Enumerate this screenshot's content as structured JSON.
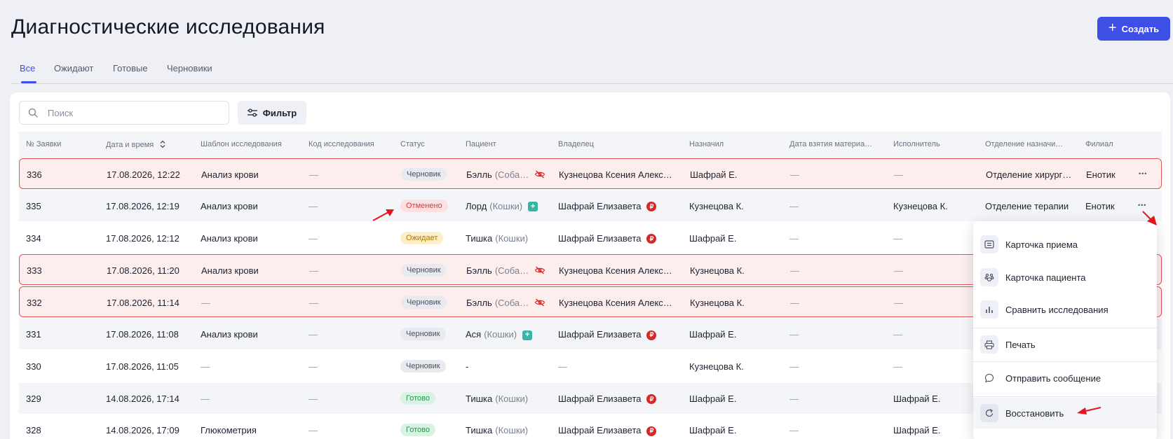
{
  "page": {
    "title": "Диагностические исследования",
    "create_label": "Создать"
  },
  "tabs": [
    {
      "label": "Все",
      "active": true
    },
    {
      "label": "Ожидают",
      "active": false
    },
    {
      "label": "Готовые",
      "active": false
    },
    {
      "label": "Черновики",
      "active": false
    }
  ],
  "toolbar": {
    "search_placeholder": "Поиск",
    "filter_label": "Фильтр"
  },
  "table": {
    "columns": [
      "№ Заявки",
      "Дата и время",
      "Шаблон исследования",
      "Код исследования",
      "Статус",
      "Пациент",
      "Владелец",
      "Назначил",
      "Дата взятия материа…",
      "Исполнитель",
      "Отделение назначи…",
      "Филиал"
    ],
    "rows": [
      {
        "id": "336",
        "datetime": "17.08.2026, 12:22",
        "template": "Анализ крови",
        "code": "—",
        "status": "Черновик",
        "status_kind": "draft",
        "patient": "Бэлль",
        "species": "(Соба…",
        "patient_icon": "eye-off-icon",
        "owner": "Кузнецова Ксения Алекс…",
        "owner_badge": "",
        "assigned": "Шафрай Е.",
        "sample_date": "—",
        "executor": "—",
        "department": "Отделение хирург…",
        "branch": "Енотик",
        "highlight": true
      },
      {
        "id": "335",
        "datetime": "17.08.2026, 12:19",
        "template": "Анализ крови",
        "code": "—",
        "status": "Отменено",
        "status_kind": "cancel",
        "patient": "Лорд",
        "species": "(Кошки)",
        "patient_icon": "medical-icon",
        "owner": "Шафрай Елизавета",
        "owner_badge": "₽",
        "assigned": "Кузнецова К.",
        "sample_date": "—",
        "executor": "Кузнецова К.",
        "department": "Отделение терапии",
        "branch": "Енотик",
        "highlight": false
      },
      {
        "id": "334",
        "datetime": "17.08.2026, 12:12",
        "template": "Анализ крови",
        "code": "—",
        "status": "Ожидает",
        "status_kind": "wait",
        "patient": "Тишка",
        "species": "(Кошки)",
        "patient_icon": "",
        "owner": "Шафрай Елизавета",
        "owner_badge": "₽",
        "assigned": "Шафрай Е.",
        "sample_date": "—",
        "executor": "—",
        "department": "",
        "branch": "",
        "highlight": false
      },
      {
        "id": "333",
        "datetime": "17.08.2026, 11:20",
        "template": "Анализ крови",
        "code": "—",
        "status": "Черновик",
        "status_kind": "draft",
        "patient": "Бэлль",
        "species": "(Соба…",
        "patient_icon": "eye-off-icon",
        "owner": "Кузнецова Ксения Алекс…",
        "owner_badge": "",
        "assigned": "Кузнецова К.",
        "sample_date": "—",
        "executor": "—",
        "department": "",
        "branch": "",
        "highlight": true
      },
      {
        "id": "332",
        "datetime": "17.08.2026, 11:14",
        "template": "—",
        "code": "—",
        "status": "Черновик",
        "status_kind": "draft",
        "patient": "Бэлль",
        "species": "(Соба…",
        "patient_icon": "eye-off-icon",
        "owner": "Кузнецова Ксения Алекс…",
        "owner_badge": "",
        "assigned": "Кузнецова К.",
        "sample_date": "—",
        "executor": "—",
        "department": "",
        "branch": "",
        "highlight": true
      },
      {
        "id": "331",
        "datetime": "17.08.2026, 11:08",
        "template": "Анализ крови",
        "code": "—",
        "status": "Черновик",
        "status_kind": "draft",
        "patient": "Ася",
        "species": "(Кошки)",
        "patient_icon": "medical-icon",
        "owner": "Шафрай Елизавета",
        "owner_badge": "₽",
        "assigned": "Шафрай Е.",
        "sample_date": "—",
        "executor": "—",
        "department": "",
        "branch": "",
        "highlight": false
      },
      {
        "id": "330",
        "datetime": "17.08.2026, 11:05",
        "template": "—",
        "code": "—",
        "status": "Черновик",
        "status_kind": "draft",
        "patient": "-",
        "species": "",
        "patient_icon": "",
        "owner": "—",
        "owner_badge": "",
        "assigned": "Кузнецова К.",
        "sample_date": "—",
        "executor": "—",
        "department": "",
        "branch": "",
        "highlight": false
      },
      {
        "id": "329",
        "datetime": "14.08.2026, 17:14",
        "template": "—",
        "code": "—",
        "status": "Готово",
        "status_kind": "ready",
        "patient": "Тишка",
        "species": "(Кошки)",
        "patient_icon": "",
        "owner": "Шафрай Елизавета",
        "owner_badge": "₽",
        "assigned": "Шафрай Е.",
        "sample_date": "—",
        "executor": "Шафрай Е.",
        "department": "",
        "branch": "",
        "highlight": false
      },
      {
        "id": "328",
        "datetime": "14.08.2026, 17:09",
        "template": "Глюкометрия",
        "code": "—",
        "status": "Готово",
        "status_kind": "ready",
        "patient": "Тишка",
        "species": "(Кошки)",
        "patient_icon": "",
        "owner": "Шафрай Елизавета",
        "owner_badge": "₽",
        "assigned": "Шафрай Е.",
        "sample_date": "—",
        "executor": "Шафрай Е.",
        "department": "",
        "branch": "",
        "highlight": false
      }
    ]
  },
  "menu": {
    "items": [
      {
        "label": "Карточка приема",
        "icon": "appointment-card-icon"
      },
      {
        "label": "Карточка пациента",
        "icon": "paw-icon"
      },
      {
        "label": "Сравнить исследования",
        "icon": "bar-chart-icon"
      },
      {
        "label": "Печать",
        "icon": "printer-icon"
      },
      {
        "label": "Отправить сообщение",
        "icon": "message-icon"
      },
      {
        "label": "Восстановить",
        "icon": "restore-icon"
      }
    ]
  },
  "colors": {
    "accent": "#3d4fe4",
    "highlight_border": "#e35252",
    "highlight_bg": "#fdeeee",
    "annotation_arrow": "#e8141b"
  }
}
